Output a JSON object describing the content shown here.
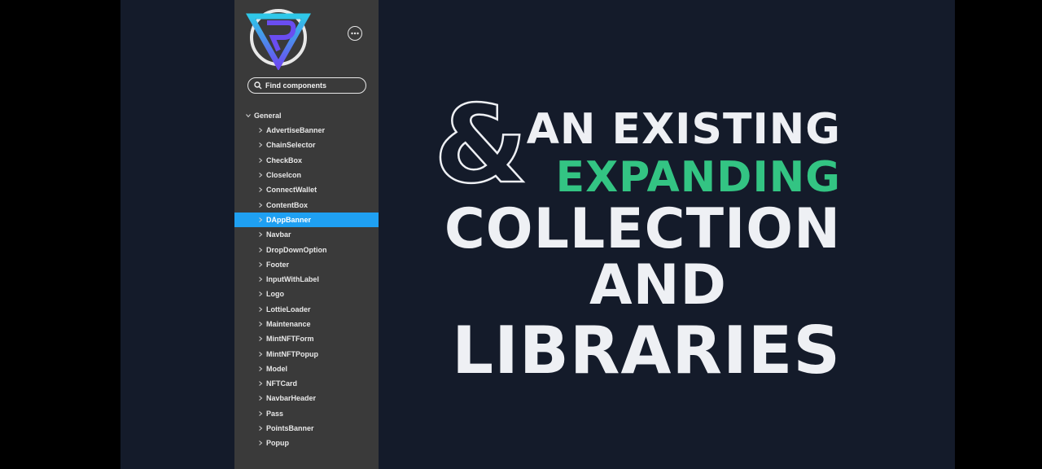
{
  "sidebar": {
    "search_placeholder": "Find components",
    "group_label": "General",
    "items": [
      "AdvertiseBanner",
      "ChainSelector",
      "CheckBox",
      "CloseIcon",
      "ConnectWallet",
      "ContentBox",
      "DAppBanner",
      "Navbar",
      "DropDownOption",
      "Footer",
      "InputWithLabel",
      "Logo",
      "LottieLoader",
      "Maintenance",
      "MintNFTForm",
      "MintNFTPopup",
      "Model",
      "NFTCard",
      "NavbarHeader",
      "Pass",
      "PointsBanner",
      "Popup"
    ],
    "selected_item": "DAppBanner"
  },
  "headline": {
    "ampersand": "&",
    "line1": "AN EXISTING",
    "line2": "EXPANDING",
    "line3": "COLLECTION",
    "line4": "AND",
    "line5": "LIBRARIES"
  },
  "colors": {
    "stage_background": "#141b2a",
    "sidebar_background": "#3a3a3a",
    "selected_item": "#1fa0f2",
    "accent_green": "#33c483",
    "logo_cyan": "#2ec8e8",
    "logo_violet": "#6a4df0"
  }
}
